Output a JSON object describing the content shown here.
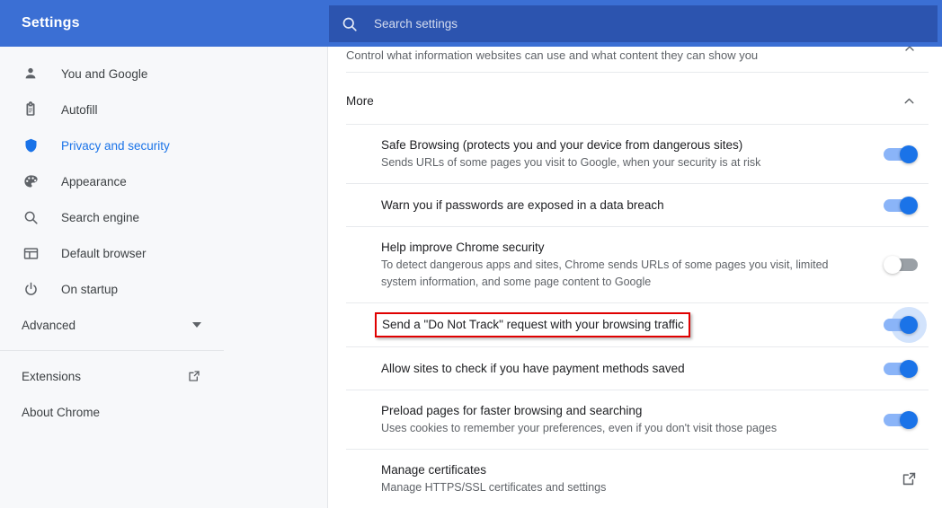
{
  "header": {
    "title": "Settings",
    "search_icon": "search-icon",
    "search_placeholder": "Search settings",
    "search_value": "",
    "bg_color": "#3B6FD4",
    "search_bg_color": "#2C54AF"
  },
  "sidebar": {
    "items": [
      {
        "label": "You and Google",
        "icon": "person-icon",
        "active": false
      },
      {
        "label": "Autofill",
        "icon": "clipboard-icon",
        "active": false
      },
      {
        "label": "Privacy and security",
        "icon": "shield-icon",
        "active": true
      },
      {
        "label": "Appearance",
        "icon": "palette-icon",
        "active": false
      },
      {
        "label": "Search engine",
        "icon": "search-icon",
        "active": false
      },
      {
        "label": "Default browser",
        "icon": "browser-window-icon",
        "active": false
      },
      {
        "label": "On startup",
        "icon": "power-icon",
        "active": false
      }
    ],
    "advanced": {
      "label": "Advanced",
      "icon": "chevron-down-icon"
    },
    "extensions": {
      "label": "Extensions",
      "icon": "external-link-icon"
    },
    "about": {
      "label": "About Chrome"
    },
    "active_color": "#1A73E8",
    "bg_color": "#F7F8FA"
  },
  "content": {
    "top_card": {
      "subtitle": "Control what information websites can use and what content they can show you",
      "chevron": "chevron-up-icon"
    },
    "section": {
      "title": "More",
      "chevron": "chevron-up-icon",
      "expanded": true
    },
    "rows": [
      {
        "title": "Safe Browsing (protects you and your device from dangerous sites)",
        "subtitle": "Sends URLs of some pages you visit to Google, when your security is at risk",
        "control": "toggle",
        "state": "on",
        "highlighted": false,
        "focused": false
      },
      {
        "title": "Warn you if passwords are exposed in a data breach",
        "subtitle": "",
        "control": "toggle",
        "state": "on",
        "highlighted": false,
        "focused": false
      },
      {
        "title": "Help improve Chrome security",
        "subtitle": "To detect dangerous apps and sites, Chrome sends URLs of some pages you visit, limited system information, and some page content to Google",
        "control": "toggle",
        "state": "off",
        "highlighted": false,
        "focused": false
      },
      {
        "title": "Send a \"Do Not Track\" request with your browsing traffic",
        "subtitle": "",
        "control": "toggle",
        "state": "on",
        "highlighted": true,
        "focused": true
      },
      {
        "title": "Allow sites to check if you have payment methods saved",
        "subtitle": "",
        "control": "toggle",
        "state": "on",
        "highlighted": false,
        "focused": false
      },
      {
        "title": "Preload pages for faster browsing and searching",
        "subtitle": "Uses cookies to remember your preferences, even if you don't visit those pages",
        "control": "toggle",
        "state": "on",
        "highlighted": false,
        "focused": false
      },
      {
        "title": "Manage certificates",
        "subtitle": "Manage HTTPS/SSL certificates and settings",
        "control": "external-link",
        "state": "",
        "highlighted": false,
        "focused": false
      }
    ],
    "highlight_color": "#E00000",
    "toggle_on_color": "#1A73E8",
    "toggle_track_on_color": "#8AB4F8",
    "toggle_off_color": "#9AA0A6"
  }
}
